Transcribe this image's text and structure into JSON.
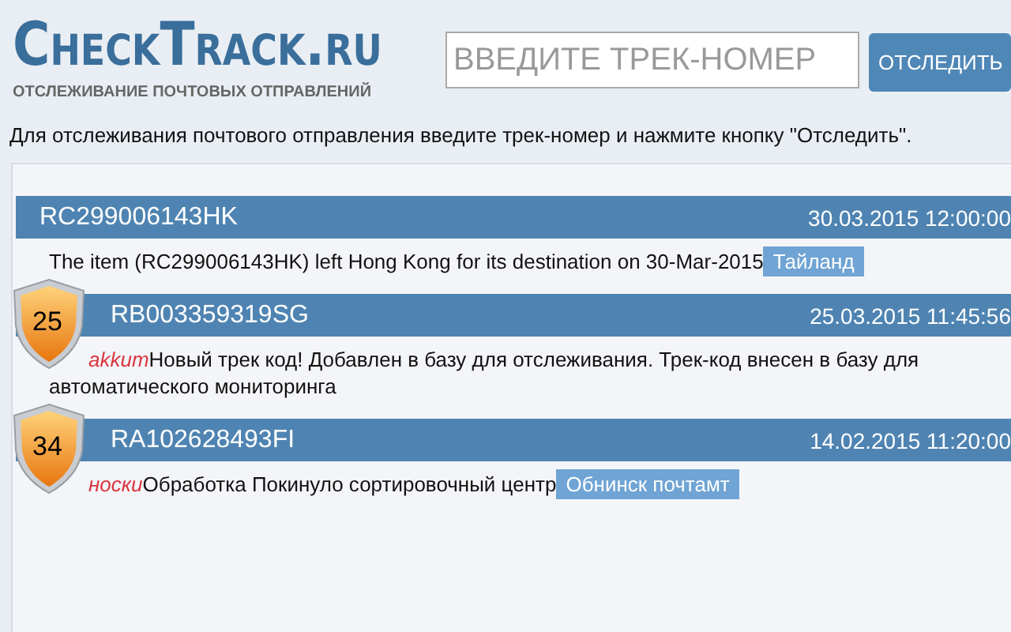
{
  "logo": {
    "title": "CheckTrack.ru",
    "tagline": "ОТСЛЕЖИВАНИЕ ПОЧТОВЫХ ОТПРАВЛЕНИЙ"
  },
  "search": {
    "placeholder": "ВВЕДИТЕ ТРЕК-НОМЕР",
    "button": "ОТСЛЕДИТЬ"
  },
  "instruction": "Для отслеживания почтового отправления введите трек-номер и нажмите кнопку \"Отследить\".",
  "parcels": [
    {
      "tracking": "RC299006143HK",
      "date": "30.03.2015 12:00:00",
      "text": "The item (RC299006143HK) left Hong Kong for its destination on 30-Mar-2015",
      "location": "Тайланд"
    },
    {
      "badge": "25",
      "tracking": "RB003359319SG",
      "date": "25.03.2015 11:45:56",
      "note": "akkum",
      "text": "Новый трек код! Добавлен в базу для отслеживания. Трек-код внесен в базу для автоматического мониторинга"
    },
    {
      "badge": "34",
      "tracking": "RA102628493FI",
      "date": "14.02.2015 11:20:00",
      "note": "носки",
      "text": "Обработка Покинуло сортировочный центр",
      "location": "Обнинск почтамт"
    }
  ]
}
